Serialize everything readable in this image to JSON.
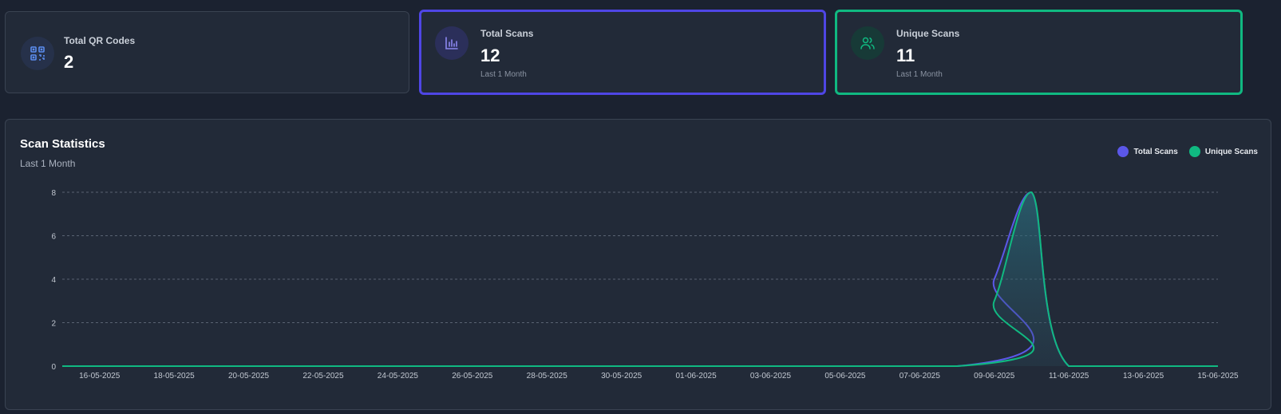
{
  "stats": [
    {
      "label": "Total QR Codes",
      "value": "2",
      "sub": "",
      "icon": "qr-code-icon"
    },
    {
      "label": "Total Scans",
      "value": "12",
      "sub": "Last 1 Month",
      "icon": "bar-chart-icon"
    },
    {
      "label": "Unique Scans",
      "value": "11",
      "sub": "Last 1 Month",
      "icon": "users-icon"
    }
  ],
  "colors": {
    "total": "#5b57e8",
    "unique": "#10b981",
    "total_border": "#4f46e5",
    "unique_border": "#10b981"
  },
  "chart": {
    "title": "Scan Statistics",
    "subtitle": "Last 1 Month",
    "legend": [
      "Total Scans",
      "Unique Scans"
    ]
  },
  "chart_data": {
    "type": "area",
    "title": "Scan Statistics",
    "subtitle": "Last 1 Month",
    "xlabel": "",
    "ylabel": "",
    "ylim": [
      0,
      8
    ],
    "yticks": [
      0,
      2,
      4,
      6,
      8
    ],
    "x_range": [
      "15-05-2025",
      "15-06-2025"
    ],
    "xtick_labels": [
      "16-05-2025",
      "18-05-2025",
      "20-05-2025",
      "22-05-2025",
      "24-05-2025",
      "26-05-2025",
      "28-05-2025",
      "30-05-2025",
      "01-06-2025",
      "03-06-2025",
      "05-06-2025",
      "07-06-2025",
      "09-06-2025",
      "11-06-2025",
      "13-06-2025",
      "15-06-2025"
    ],
    "grid": true,
    "legend_position": "top-right",
    "series": [
      {
        "name": "Total Scans",
        "x": [
          "15-05-2025",
          "08-06-2025",
          "09-06-2025",
          "10-06-2025",
          "11-06-2025",
          "15-06-2025"
        ],
        "values": [
          0,
          0,
          4,
          8,
          0,
          0
        ]
      },
      {
        "name": "Unique Scans",
        "x": [
          "15-05-2025",
          "08-06-2025",
          "09-06-2025",
          "10-06-2025",
          "11-06-2025",
          "15-06-2025"
        ],
        "values": [
          0,
          0,
          3,
          8,
          0,
          0
        ]
      }
    ]
  }
}
